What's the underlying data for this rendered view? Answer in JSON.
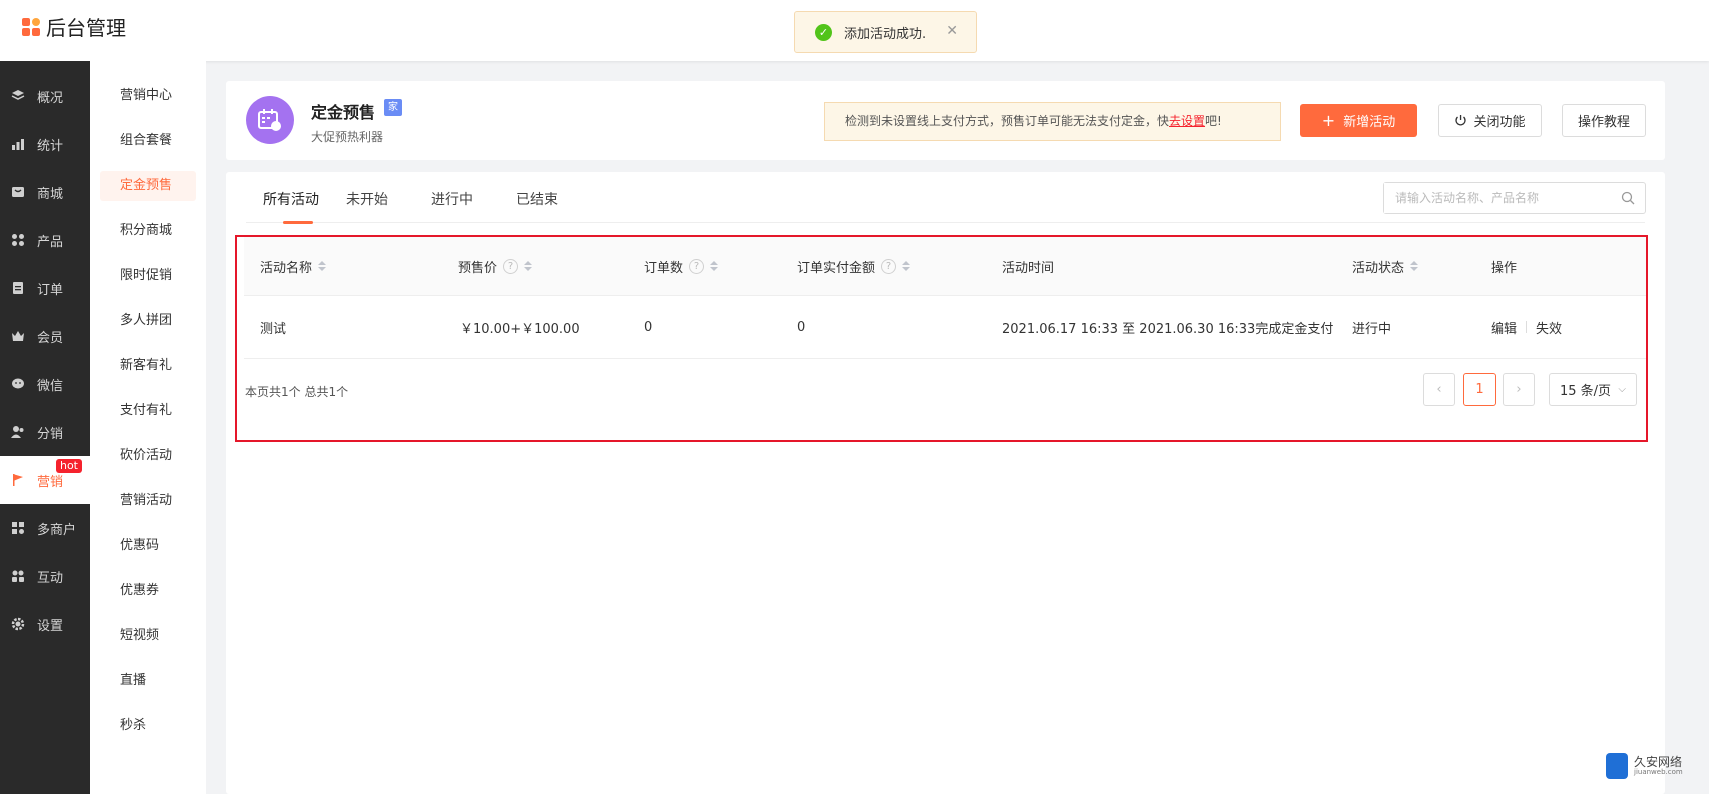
{
  "app": {
    "title": "后台管理"
  },
  "toast": {
    "message": "添加活动成功."
  },
  "sidebar": {
    "items": [
      {
        "label": "概况",
        "icon": "layers-icon"
      },
      {
        "label": "统计",
        "icon": "stats-icon"
      },
      {
        "label": "商城",
        "icon": "store-icon"
      },
      {
        "label": "产品",
        "icon": "grid-icon"
      },
      {
        "label": "订单",
        "icon": "order-icon"
      },
      {
        "label": "会员",
        "icon": "crown-icon"
      },
      {
        "label": "微信",
        "icon": "wechat-icon"
      },
      {
        "label": "分销",
        "icon": "users-icon"
      },
      {
        "label": "营销",
        "icon": "flag-icon",
        "badge": "hot",
        "active": true
      },
      {
        "label": "多商户",
        "icon": "shop-icon"
      },
      {
        "label": "互动",
        "icon": "interact-icon"
      },
      {
        "label": "设置",
        "icon": "gear-icon"
      }
    ]
  },
  "subnav": {
    "items": [
      "营销中心",
      "组合套餐",
      "定金预售",
      "积分商城",
      "限时促销",
      "多人拼团",
      "新客有礼",
      "支付有礼",
      "砍价活动",
      "营销活动",
      "优惠码",
      "优惠券",
      "短视频",
      "直播",
      "秒杀"
    ],
    "active": "定金预售"
  },
  "feature": {
    "name": "定金预售",
    "tag": "家",
    "subtitle": "大促预热利器",
    "warning_text": "检测到未设置线上支付方式，预售订单可能无法支付定金，快",
    "warning_link": "去设置",
    "warning_suffix": "吧!",
    "add_button": "新增活动",
    "close_button": "关闭功能",
    "tutorial_button": "操作教程"
  },
  "tabs": [
    "所有活动",
    "未开始",
    "进行中",
    "已结束"
  ],
  "search": {
    "placeholder": "请输入活动名称、产品名称"
  },
  "table": {
    "columns": [
      "活动名称",
      "预售价",
      "订单数",
      "订单实付金额",
      "活动时间",
      "活动状态",
      "操作"
    ],
    "rows": [
      {
        "name": "测试",
        "price": "￥10.00+￥100.00",
        "orders": "0",
        "paid": "0",
        "time": "2021.06.17 16:33 至 2021.06.30 16:33完成定金支付",
        "status": "进行中",
        "actions": [
          "编辑",
          "失效"
        ]
      }
    ]
  },
  "pagination": {
    "summary": "本页共1个 总共1个",
    "current": "1",
    "page_size": "15 条/页"
  },
  "watermark": {
    "name": "久安网络",
    "url": "jiuanweb.com"
  },
  "colors": {
    "accent": "#ff6a3d",
    "sidebar": "#2a2a2a",
    "highlight": "#e5172a",
    "success": "#52c41a"
  }
}
